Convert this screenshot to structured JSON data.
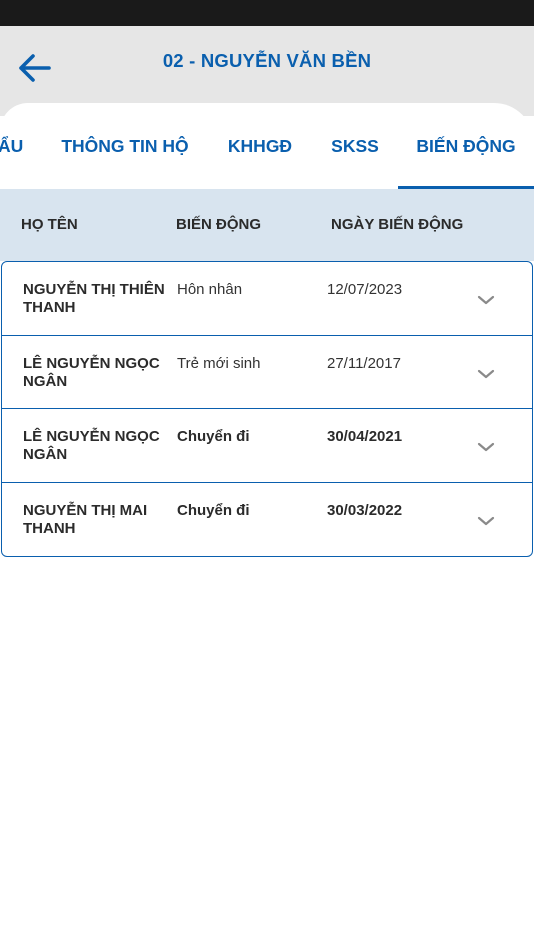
{
  "header": {
    "title": "02 - NGUYỄN VĂN BỀN"
  },
  "tabs": [
    {
      "label": "ẨU",
      "active": false
    },
    {
      "label": "THÔNG TIN HỘ",
      "active": false
    },
    {
      "label": "KHHGĐ",
      "active": false
    },
    {
      "label": "SKSS",
      "active": false
    },
    {
      "label": "BIẾN ĐỘNG",
      "active": true
    }
  ],
  "table": {
    "columns": [
      "HỌ TÊN",
      "BIẾN ĐỘNG",
      "NGÀY BIẾN ĐỘNG"
    ],
    "rows": [
      {
        "name": "NGUYỄN THỊ THIÊN THANH",
        "event": "Hôn nhân",
        "date": "12/07/2023"
      },
      {
        "name": "LÊ NGUYỄN NGỌC NGÂN",
        "event": "Trẻ mới sinh",
        "date": "27/11/2017"
      },
      {
        "name": "LÊ NGUYỄN NGỌC NGÂN",
        "event": "Chuyển đi",
        "date": "30/04/2021"
      },
      {
        "name": "NGUYỄN THỊ MAI THANH",
        "event": "Chuyển đi",
        "date": "30/03/2022"
      }
    ]
  },
  "icons": {
    "back": "arrow-left-icon",
    "expand": "chevron-down-icon"
  },
  "colors": {
    "accent": "#0a5fae",
    "header_bg": "#e6e6e6",
    "table_header_bg": "#d8e4ef",
    "status_bar": "#1a1a1a"
  }
}
